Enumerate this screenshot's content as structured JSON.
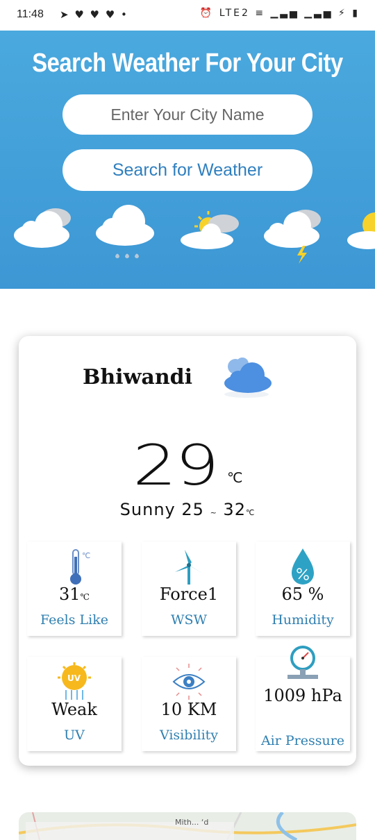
{
  "status_bar": {
    "time": "11:48",
    "left_icons": "➤ ♥ ♥ ♥ •",
    "right_icons": "⏰ LTE2 ≡ ▁▃▅ ▁▃▅ ⚡ ▮"
  },
  "hero": {
    "title": "Search Weather For Your City",
    "city_input_placeholder": "Enter Your City Name",
    "search_button_label": "Search for Weather"
  },
  "weather": {
    "city": "Bhiwandi",
    "temperature": "29",
    "temperature_unit": "℃",
    "condition": "Sunny",
    "low": "25",
    "range_sep": "~",
    "high": "32",
    "range_unit": "℃"
  },
  "details": [
    {
      "icon": "thermometer-icon",
      "value": "31",
      "unit": "℃",
      "label": "Feels Like"
    },
    {
      "icon": "wind-turbine-icon",
      "value": "Force1",
      "unit": "",
      "label": "WSW"
    },
    {
      "icon": "humidity-drop-icon",
      "value": "65 %",
      "unit": "",
      "label": "Humidity"
    },
    {
      "icon": "uv-sun-icon",
      "value": "Weak",
      "unit": "",
      "label": "UV"
    },
    {
      "icon": "visibility-eye-icon",
      "value": "10 KM",
      "unit": "",
      "label": "Visibility"
    },
    {
      "icon": "pressure-gauge-icon",
      "value": "1009 hPa",
      "unit": "",
      "label": "Air Pressure"
    }
  ],
  "map": {
    "visible_text": "Mith... ‘d"
  },
  "colors": {
    "hero_bg": "#3d97d4",
    "accent": "#2f7fb0",
    "card_bg": "#ffffff"
  }
}
